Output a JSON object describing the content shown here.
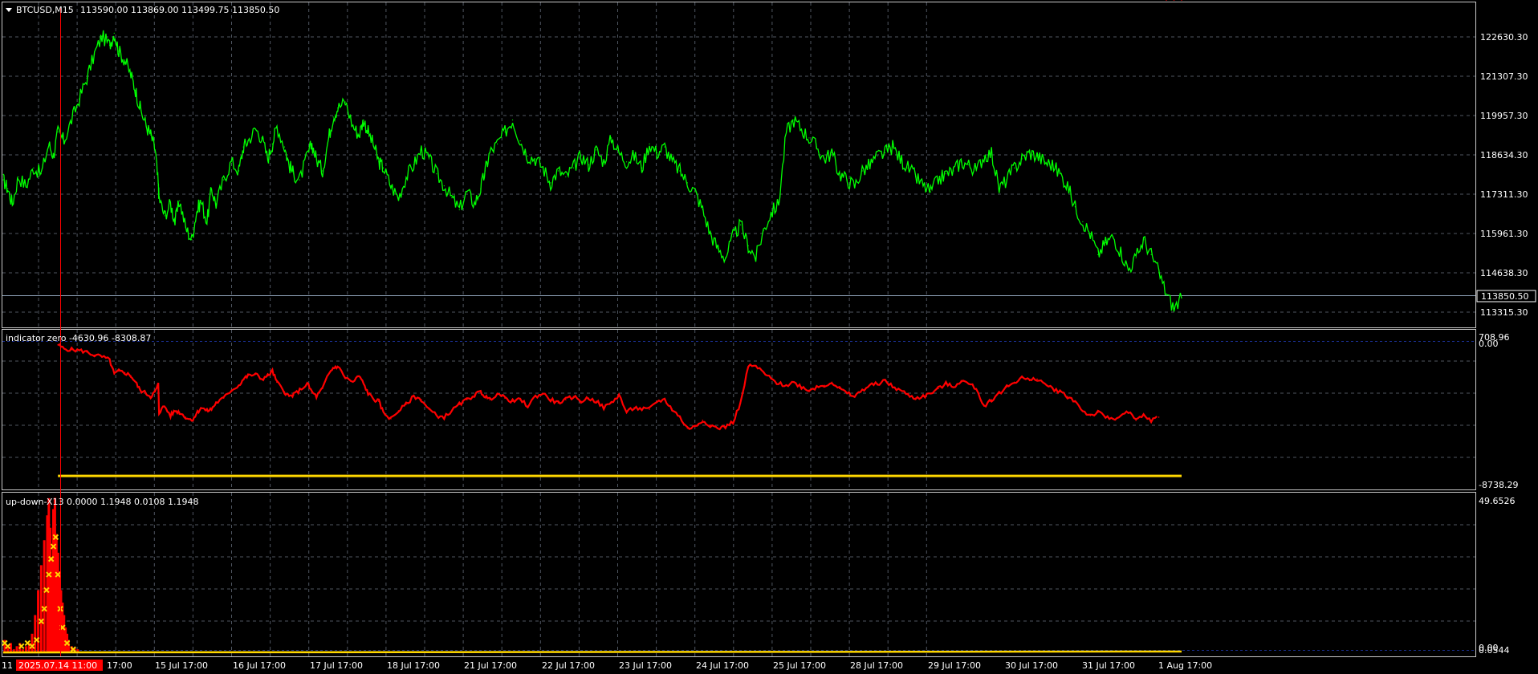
{
  "colors": {
    "background": "#000000",
    "grid": "#707a8a",
    "frame": "#c8c8c8",
    "text": "#ffffff",
    "price_line": "#00ff00",
    "indicator_line": "#ff0000",
    "level_line": "#ffd700",
    "bid_line": "#8fa2b8",
    "crosshair": "#ff0000",
    "date_highlight_bg": "#ff0000",
    "marker": "#ffd700",
    "zero_dotted": "#1a2f8f"
  },
  "main_chart": {
    "header_icon": "triangle-down-icon",
    "symbol": "BTCUSD,M15",
    "ohlc": "113590.00 113869.00 113499.75 113850.50",
    "price_axis": [
      "122630.30",
      "121307.30",
      "119957.30",
      "118634.30",
      "117311.30",
      "115961.30",
      "114638.30",
      "113315.30"
    ],
    "current_price_label": "113850.50",
    "chart_data": {
      "type": "line",
      "title": "BTCUSD,M15",
      "ylim": [
        112900,
        123700
      ],
      "grid": true,
      "series": [
        {
          "name": "BTCUSD",
          "x": [
            0,
            0.3,
            0.6,
            1,
            1.5,
            2,
            2.5,
            3,
            3.3,
            3.6,
            4,
            4.5,
            5,
            5.5,
            6,
            6.5,
            7,
            7.3,
            7.6,
            8,
            8.4,
            8.7,
            9.0,
            9.4,
            9.7,
            10.0,
            10.2,
            10.25,
            10.6,
            11,
            11.3,
            11.6,
            12,
            12.4,
            12.7,
            13,
            13.4,
            13.7,
            14,
            14.5,
            15,
            15.5,
            15.8,
            16.1,
            16.6,
            17,
            17.4,
            17.7,
            18,
            18.5,
            18.8,
            19.1,
            19.5,
            20,
            20.3,
            20.6,
            21,
            21.4,
            21.7,
            22,
            22.5,
            23,
            23.4,
            23.7,
            24,
            24.4,
            24.7,
            25,
            25.5,
            26,
            26.5,
            27,
            27.5,
            28,
            28.5,
            29,
            29.5,
            30,
            30.5,
            31,
            31.4,
            31.7,
            32,
            32.5,
            33,
            33.5,
            34,
            34.5,
            35,
            35.5,
            36,
            36.5,
            37,
            37.5,
            38,
            38.5,
            39,
            39.5,
            40,
            40.5,
            41,
            41.5,
            42,
            42.5,
            43,
            43.5,
            44,
            44.5,
            45,
            45.5,
            46,
            46.5,
            47,
            47.5,
            48,
            48.5,
            49,
            49.5,
            50,
            50.5,
            51,
            51.5,
            52,
            52.5,
            53,
            53.5,
            54,
            54.5,
            55,
            55.5,
            56,
            56.5,
            57,
            57.5,
            58,
            58.5,
            59,
            59.5,
            60,
            60.5,
            61,
            61.5,
            62,
            62.5,
            63,
            63.5,
            64,
            64.5,
            65,
            65.5,
            66,
            66.5,
            67,
            67.5,
            68,
            68.5,
            69,
            69.5,
            70,
            70.5,
            71,
            71.5,
            72,
            72.5,
            73,
            73.5,
            74,
            74.5,
            75,
            75.5,
            76,
            76.5,
            77,
            77.5
          ],
          "y": [
            117800,
            117500,
            117000,
            117900,
            117600,
            118200,
            118000,
            119000,
            118600,
            119400,
            119100,
            119800,
            120500,
            121200,
            122000,
            122600,
            122300,
            122700,
            122100,
            121800,
            121300,
            120800,
            120200,
            119600,
            119300,
            118800,
            117600,
            117200,
            116600,
            117000,
            116400,
            117100,
            116200,
            115800,
            116700,
            117100,
            116400,
            117500,
            117000,
            117800,
            118400,
            118100,
            118900,
            119100,
            119500,
            119200,
            118500,
            119000,
            119600,
            118900,
            118300,
            118000,
            117800,
            118600,
            119000,
            118500,
            118100,
            119200,
            119900,
            120200,
            120400,
            119600,
            119300,
            119800,
            119400,
            118900,
            118400,
            118200,
            117600,
            117200,
            117900,
            118300,
            118800,
            118500,
            118000,
            117600,
            117200,
            116800,
            117400,
            117000,
            117500,
            118100,
            118700,
            119000,
            119400,
            119800,
            119100,
            118600,
            118500,
            118200,
            117700,
            118100,
            117900,
            118200,
            118600,
            118300,
            118800,
            118400,
            119200,
            118700,
            118400,
            118600,
            118200,
            119000,
            118700,
            118900,
            118400,
            118100,
            117700,
            117400,
            116800,
            116000,
            115500,
            115200,
            115900,
            116300,
            115600,
            115200,
            116100,
            116700,
            117000,
            119400,
            119800,
            119500,
            119200,
            118900,
            118500,
            118700,
            118000,
            117800,
            117600,
            118100,
            118300,
            118600,
            118700,
            118900,
            118500,
            118200,
            117900,
            117600,
            117400,
            117800,
            118000,
            118100,
            118400,
            118300,
            118100,
            118600,
            118700,
            117500,
            117800,
            118200,
            118500,
            118700,
            118600,
            118400,
            118300,
            118000,
            117600,
            116900,
            116400,
            116000,
            115300,
            115700,
            115900,
            115400,
            114800,
            115200,
            115800,
            115300,
            114700,
            114000,
            113500,
            113850
          ]
        }
      ]
    }
  },
  "indicator_pane": {
    "label": "indicator zero -4630.96 -8308.87",
    "axis_top_a": "708.96",
    "axis_top_b": "0.00",
    "axis_bottom": "-8738.29",
    "chart_data": {
      "type": "line",
      "ylim": [
        -9100,
        900
      ],
      "grid": true,
      "series": [
        {
          "name": "indicator zero",
          "x": [
            3.6,
            4,
            4.5,
            5,
            5.5,
            6,
            6.5,
            7,
            7.3,
            7.6,
            8,
            8.4,
            8.7,
            9.0,
            9.4,
            9.7,
            10.0,
            10.2,
            10.25,
            10.6,
            11,
            11.3,
            11.6,
            12,
            12.4,
            12.7,
            13,
            13.4,
            13.7,
            14,
            14.5,
            15,
            15.5,
            15.8,
            16.1,
            16.6,
            17,
            17.4,
            17.7,
            18,
            18.5,
            18.8,
            19.1,
            19.5,
            20,
            20.3,
            20.6,
            21,
            21.4,
            21.7,
            22,
            22.5,
            23,
            23.4,
            23.7,
            24,
            24.4,
            24.7,
            25,
            25.5,
            26,
            26.5,
            27,
            27.5,
            28,
            28.5,
            29,
            29.5,
            30,
            30.5,
            31,
            31.4,
            31.7,
            32,
            32.5,
            33,
            33.5,
            34,
            34.5,
            35,
            35.5,
            36,
            36.5,
            37,
            37.5,
            38,
            38.5,
            39,
            39.5,
            40,
            40.5,
            41,
            41.5,
            42,
            42.5,
            43,
            43.5,
            44,
            44.5,
            45,
            45.5,
            46,
            46.5,
            47,
            47.5,
            48,
            48.5,
            49,
            49.5,
            50,
            50.5,
            51,
            51.5,
            52,
            52.5,
            53,
            53.5,
            54,
            54.5,
            55,
            55.5,
            56,
            56.5,
            57,
            57.5,
            58,
            58.5,
            59,
            59.5,
            60,
            60.5,
            61,
            61.5,
            62,
            62.5,
            63,
            63.5,
            64,
            64.5,
            65,
            65.5,
            66,
            66.5,
            67,
            67.5,
            68,
            68.5,
            69,
            69.5,
            70,
            70.5,
            71,
            71.5,
            72,
            72.5,
            73,
            73.5,
            74,
            74.5,
            75,
            75.5,
            76,
            76.5,
            77,
            77.5
          ],
          "y": [
            -50,
            -300,
            -350,
            -400,
            -500,
            -700,
            -800,
            -1000,
            -1900,
            -1700,
            -1800,
            -2000,
            -2400,
            -2900,
            -3100,
            -3300,
            -3000,
            -2500,
            -4300,
            -3900,
            -4500,
            -4200,
            -4300,
            -4600,
            -4800,
            -4400,
            -4000,
            -4200,
            -4100,
            -3700,
            -3400,
            -2900,
            -2600,
            -2200,
            -2000,
            -1900,
            -2200,
            -2000,
            -1700,
            -2400,
            -3000,
            -3300,
            -3200,
            -2900,
            -2500,
            -3000,
            -3300,
            -2800,
            -1900,
            -1500,
            -1400,
            -2100,
            -2400,
            -2000,
            -2500,
            -3100,
            -3500,
            -3600,
            -4300,
            -4700,
            -4200,
            -3800,
            -3300,
            -3500,
            -4100,
            -4500,
            -4600,
            -4200,
            -3800,
            -3500,
            -3200,
            -3000,
            -3300,
            -3500,
            -3100,
            -3400,
            -3600,
            -3500,
            -3900,
            -3300,
            -3100,
            -3500,
            -3700,
            -3500,
            -3300,
            -3600,
            -3400,
            -3600,
            -4000,
            -3700,
            -3200,
            -4300,
            -4000,
            -4100,
            -4100,
            -3600,
            -3500,
            -4100,
            -4600,
            -5300,
            -5200,
            -4800,
            -5100,
            -5300,
            -5200,
            -4900,
            -3700,
            -1400,
            -1400,
            -1800,
            -2200,
            -2500,
            -2600,
            -2400,
            -2700,
            -2900,
            -2700,
            -2600,
            -2400,
            -2800,
            -3100,
            -3300,
            -2900,
            -2600,
            -2500,
            -2300,
            -2700,
            -2900,
            -3200,
            -3400,
            -3300,
            -3100,
            -2800,
            -2500,
            -2700,
            -2300,
            -2500,
            -2800,
            -3900,
            -3500,
            -3100,
            -2700,
            -2400,
            -2100,
            -2300,
            -2200,
            -2500,
            -2800,
            -3000,
            -3300,
            -3600,
            -4200,
            -4500,
            -4300,
            -4600,
            -4700,
            -4500,
            -4300,
            -4800,
            -4500,
            -4800,
            -4600
          ]
        },
        {
          "name": "level",
          "x": [
            3.6,
            77.5
          ],
          "y": [
            -8300,
            -8300
          ]
        }
      ]
    }
  },
  "updown_pane": {
    "label": "up-down-X13 0.0000 1.1948 0.0108 1.1948",
    "axis_top": "49.6526",
    "axis_bottom_a": "0.00",
    "axis_bottom_b": "0.0544",
    "chart_data": {
      "type": "scatter",
      "ylim": [
        -1,
        50.5
      ],
      "grid": true,
      "series": [
        {
          "name": "histogram",
          "x": [
            0.1,
            0.3,
            0.5,
            0.7,
            0.9,
            1.1,
            1.3,
            1.5,
            1.7,
            1.9,
            2.1,
            2.3,
            2.5,
            2.7,
            2.9,
            3.0,
            3.1,
            3.2,
            3.3,
            3.4,
            3.5,
            3.6,
            3.7,
            3.8,
            3.9,
            4.0,
            4.1,
            4.2,
            4.3,
            4.5,
            4.7,
            4.9
          ],
          "y": [
            4,
            2,
            3,
            1,
            2,
            3,
            1,
            2,
            3,
            6,
            12,
            20,
            28,
            36,
            44,
            49.5,
            40,
            30,
            46,
            49.6,
            38,
            32,
            26,
            20,
            16,
            12,
            8,
            6,
            4,
            2,
            1.5,
            1
          ]
        },
        {
          "name": "markers",
          "x": [
            0.1,
            0.3,
            1.2,
            1.6,
            1.9,
            2.2,
            2.5,
            2.7,
            2.85,
            3.0,
            3.15,
            3.3,
            3.45,
            3.6,
            3.75,
            3.9,
            4.2,
            4.6
          ],
          "y": [
            3,
            2,
            2,
            3,
            2,
            4,
            10,
            14,
            20,
            25,
            30,
            34,
            37,
            25,
            14,
            8,
            3,
            1
          ]
        },
        {
          "name": "baseline",
          "x": [
            0,
            77.5
          ],
          "y": [
            0,
            0.3
          ]
        }
      ]
    }
  },
  "time_axis": {
    "start_partial": "11",
    "highlight_label": "2025.07.14 11:00",
    "labels": [
      "17:00",
      "15 Jul 17:00",
      "16 Jul 17:00",
      "17 Jul 17:00",
      "18 Jul 17:00",
      "21 Jul 17:00",
      "22 Jul 17:00",
      "23 Jul 17:00",
      "24 Jul 17:00",
      "25 Jul 17:00",
      "28 Jul 17:00",
      "29 Jul 17:00",
      "30 Jul 17:00",
      "31 Jul 17:00",
      "1 Aug 17:00"
    ]
  }
}
